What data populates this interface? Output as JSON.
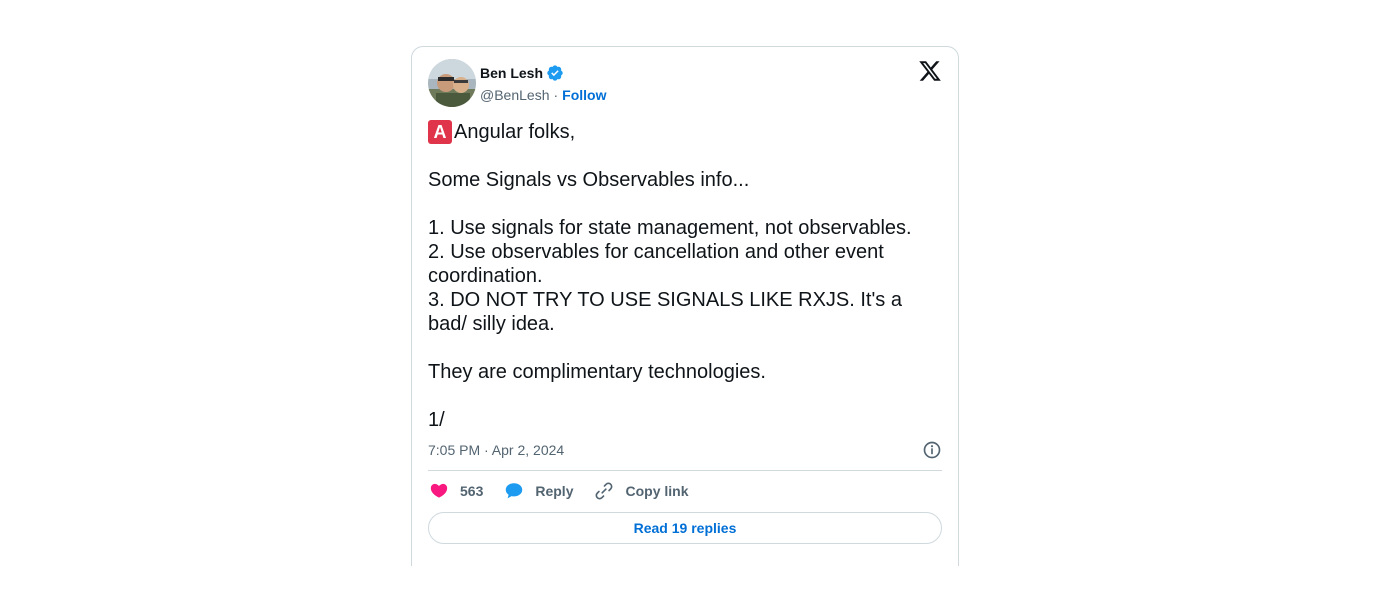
{
  "author": {
    "display_name": "Ben Lesh",
    "handle": "@BenLesh",
    "separator": "·",
    "follow_label": "Follow",
    "verified_icon": "verified-badge-icon",
    "accent_color": "#1d9bf0"
  },
  "tweet": {
    "badge_letter": "A",
    "line1": "Angular folks,",
    "body": "\n\nSome Signals vs Observables info...\n\n1. Use signals for state management, not observables.\n2. Use observables for cancellation and other event coordination.\n3. DO NOT TRY TO USE SIGNALS LIKE RXJS. It's a bad/ silly idea.\n\nThey are complimentary technologies.\n\n1/",
    "timestamp": "7:05 PM · Apr 2, 2024"
  },
  "actions": {
    "likes": "563",
    "reply_label": "Reply",
    "copy_link_label": "Copy link",
    "like_color": "#f91880",
    "reply_color": "#1d9bf0"
  },
  "footer": {
    "read_replies_label": "Read 19 replies"
  }
}
